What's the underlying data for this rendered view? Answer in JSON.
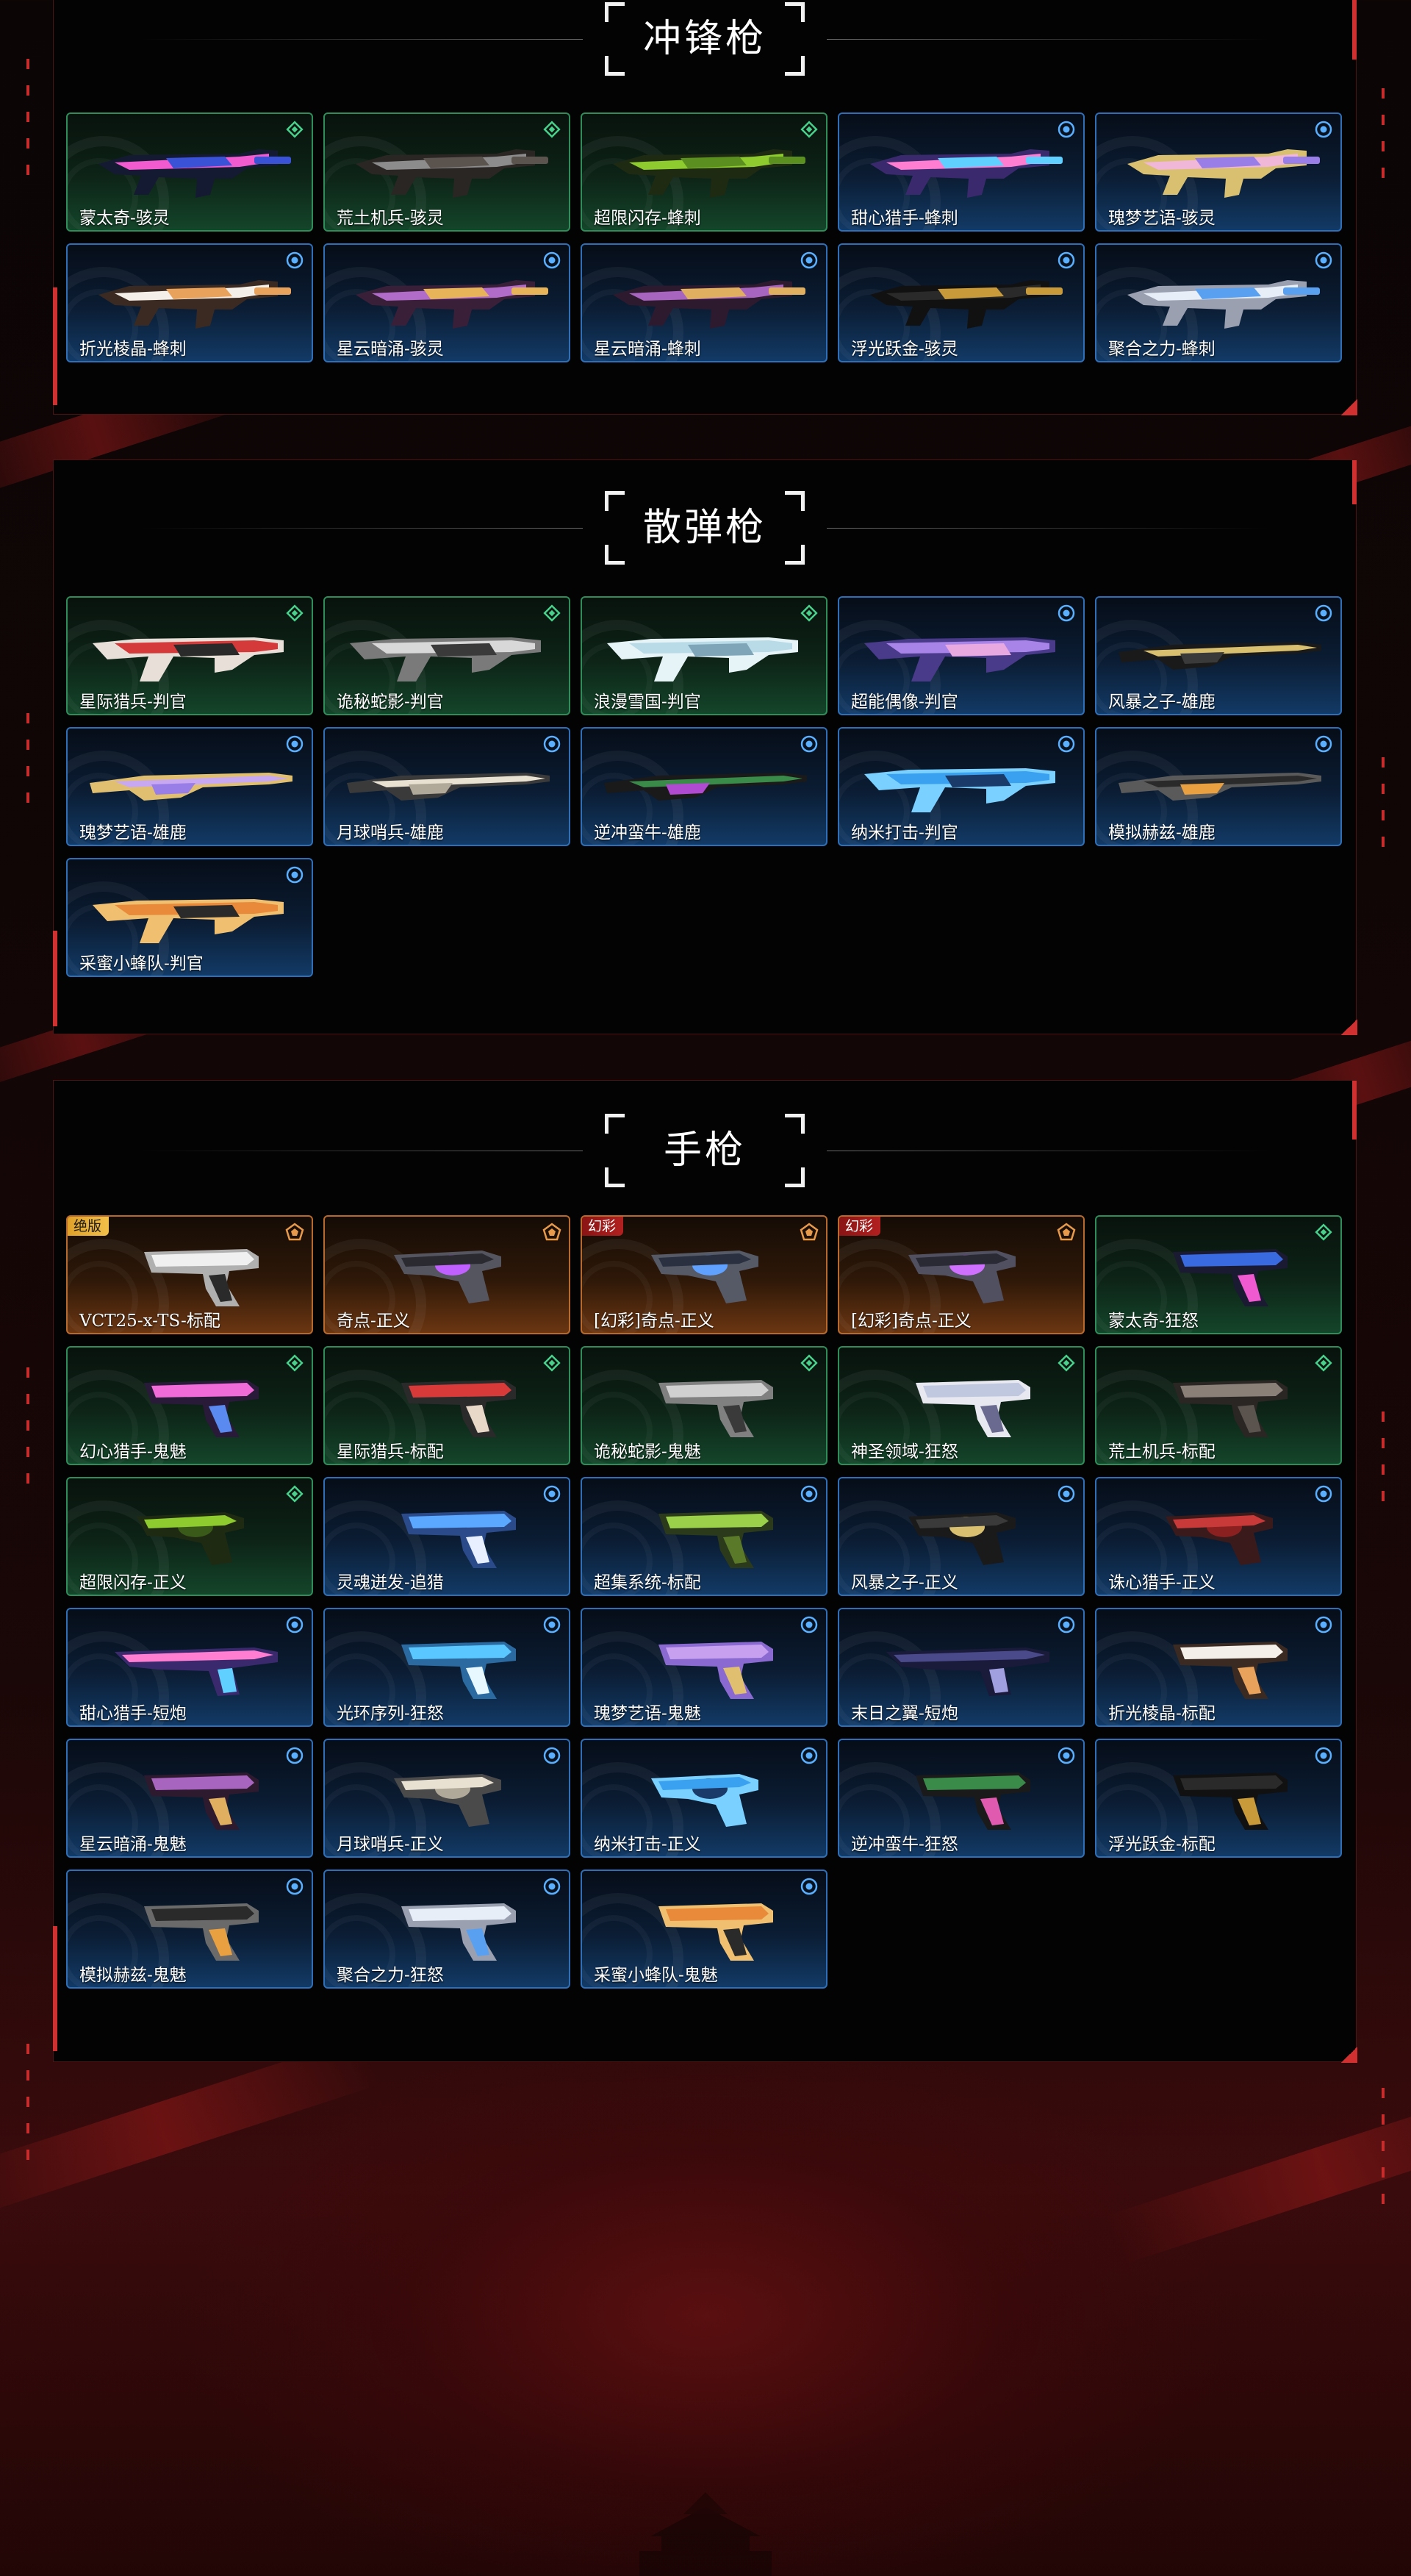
{
  "colors": {
    "accent_red": "#d0302f",
    "card_green": "#2f8d5a",
    "card_blue": "#2e6fb8",
    "card_orange": "#b86a2c",
    "gold_badge": "#e8b03a"
  },
  "sections": [
    {
      "title": "冲锋枪",
      "items": [
        {
          "name": "蒙太奇-骇灵",
          "tier": "green",
          "weapon": "smg",
          "hue": [
            "#f25bd0",
            "#3a53d6",
            "#151a33"
          ]
        },
        {
          "name": "荒土机兵-骇灵",
          "tier": "green",
          "weapon": "smg",
          "hue": [
            "#8c8c8c",
            "#5a534e",
            "#2a2624"
          ]
        },
        {
          "name": "超限闪存-蜂刺",
          "tier": "green",
          "weapon": "smg",
          "hue": [
            "#8ecb2e",
            "#5b8f1f",
            "#1f2a12"
          ]
        },
        {
          "name": "甜心猎手-蜂刺",
          "tier": "blue",
          "weapon": "smg",
          "hue": [
            "#ff7ed1",
            "#5fd0ff",
            "#3a2a6d"
          ]
        },
        {
          "name": "瑰梦艺语-骇灵",
          "tier": "blue",
          "weapon": "smg",
          "hue": [
            "#f0b7d9",
            "#9a7ee8",
            "#d9c070"
          ]
        },
        {
          "name": "折光棱晶-蜂刺",
          "tier": "blue",
          "weapon": "smg",
          "hue": [
            "#f4efe8",
            "#e8a25c",
            "#3a2a22"
          ]
        },
        {
          "name": "星云暗涌-骇灵",
          "tier": "blue",
          "weapon": "smg",
          "hue": [
            "#b06cc8",
            "#e8b45a",
            "#3a1f38"
          ]
        },
        {
          "name": "星云暗涌-蜂刺",
          "tier": "blue",
          "weapon": "smg",
          "hue": [
            "#a865c0",
            "#e0b060",
            "#2e1a2e"
          ]
        },
        {
          "name": "浮光跃金-骇灵",
          "tier": "blue",
          "weapon": "smg",
          "hue": [
            "#2a2a2a",
            "#c89a3a",
            "#111111"
          ]
        },
        {
          "name": "聚合之力-蜂刺",
          "tier": "blue",
          "weapon": "smg",
          "hue": [
            "#e8eef8",
            "#5aa0f0",
            "#9aa0b0"
          ]
        }
      ]
    },
    {
      "title": "散弹枪",
      "items": [
        {
          "name": "星际猎兵-判官",
          "tier": "green",
          "weapon": "shotgun",
          "hue": [
            "#d43a3a",
            "#2a2a2a",
            "#e8e0d8"
          ]
        },
        {
          "name": "诡秘蛇影-判官",
          "tier": "green",
          "weapon": "shotgun",
          "hue": [
            "#d8d8d8",
            "#3a3a3a",
            "#7a7a7a"
          ]
        },
        {
          "name": "浪漫雪国-判官",
          "tier": "green",
          "weapon": "shotgun",
          "hue": [
            "#b9dbe8",
            "#7fa6b8",
            "#e6f4f8"
          ]
        },
        {
          "name": "超能偶像-判官",
          "tier": "blue",
          "weapon": "shotgun",
          "hue": [
            "#a884e8",
            "#e8a8e0",
            "#4a3a8a"
          ]
        },
        {
          "name": "风暴之子-雄鹿",
          "tier": "blue",
          "weapon": "rifle",
          "hue": [
            "#d8c070",
            "#3a3a3a",
            "#1a1a1a"
          ]
        },
        {
          "name": "瑰梦艺语-雄鹿",
          "tier": "blue",
          "weapon": "rifle",
          "hue": [
            "#c8a8f0",
            "#9a7ee8",
            "#e0c070"
          ]
        },
        {
          "name": "月球哨兵-雄鹿",
          "tier": "blue",
          "weapon": "rifle",
          "hue": [
            "#e8e0d0",
            "#b0a898",
            "#3a3a3a"
          ]
        },
        {
          "name": "逆冲蛮牛-雄鹿",
          "tier": "blue",
          "weapon": "rifle",
          "hue": [
            "#3a8a4a",
            "#b04ad0",
            "#1a1a1a"
          ]
        },
        {
          "name": "纳米打击-判官",
          "tier": "blue",
          "weapon": "shotgun",
          "hue": [
            "#3aa0f0",
            "#1a3a6a",
            "#7ad0ff"
          ]
        },
        {
          "name": "模拟赫兹-雄鹿",
          "tier": "blue",
          "weapon": "rifle",
          "hue": [
            "#2a2a2a",
            "#e8a040",
            "#5a5a5a"
          ]
        },
        {
          "name": "采蜜小蜂队-判官",
          "tier": "blue",
          "weapon": "shotgun",
          "hue": [
            "#e88a3a",
            "#2a2a2a",
            "#f0c070"
          ]
        }
      ]
    },
    {
      "title": "手枪",
      "items": [
        {
          "name": "VCT25-x-TS-标配",
          "tier": "orange",
          "weapon": "pistol",
          "badge": "绝版",
          "badge_style": "gold",
          "hue": [
            "#f0f0f0",
            "#2a2a2a",
            "#b0b0b0"
          ]
        },
        {
          "name": "奇点-正义",
          "tier": "orange",
          "weapon": "revolver",
          "hue": [
            "#2a2a30",
            "#c060ff",
            "#555560"
          ]
        },
        {
          "name": "[幻彩]奇点-正义",
          "tier": "orange",
          "weapon": "revolver",
          "badge": "幻彩",
          "badge_style": "red",
          "hue": [
            "#2a3040",
            "#60a0ff",
            "#555a66"
          ]
        },
        {
          "name": "[幻彩]奇点-正义",
          "tier": "orange",
          "weapon": "revolver",
          "badge": "幻彩",
          "badge_style": "red",
          "hue": [
            "#2a2a35",
            "#d070ff",
            "#505060"
          ]
        },
        {
          "name": "蒙太奇-狂怒",
          "tier": "green",
          "weapon": "pistol",
          "hue": [
            "#3a6ae0",
            "#f05ad0",
            "#1a1a33"
          ]
        },
        {
          "name": "幻心猎手-鬼魅",
          "tier": "green",
          "weapon": "pistol",
          "hue": [
            "#f06ad8",
            "#5a8af0",
            "#2a1a3a"
          ]
        },
        {
          "name": "星际猎兵-标配",
          "tier": "green",
          "weapon": "pistol",
          "hue": [
            "#d83a3a",
            "#e8d8c8",
            "#2a2a2a"
          ]
        },
        {
          "name": "诡秘蛇影-鬼魅",
          "tier": "green",
          "weapon": "pistol",
          "hue": [
            "#d0d0d0",
            "#3a3a3a",
            "#808080"
          ]
        },
        {
          "name": "神圣领域-狂怒",
          "tier": "green",
          "weapon": "pistol",
          "hue": [
            "#c0c8e0",
            "#6a6a90",
            "#e8e8f0"
          ]
        },
        {
          "name": "荒土机兵-标配",
          "tier": "green",
          "weapon": "pistol",
          "hue": [
            "#8a8078",
            "#5a534e",
            "#2a2624"
          ]
        },
        {
          "name": "超限闪存-正义",
          "tier": "green",
          "weapon": "revolver",
          "hue": [
            "#8ecb2e",
            "#3a5a1a",
            "#1f2a12"
          ]
        },
        {
          "name": "灵魂迸发-追猎",
          "tier": "blue",
          "weapon": "pistol",
          "hue": [
            "#5aa8ff",
            "#e8f0ff",
            "#2a4a8a"
          ]
        },
        {
          "name": "超集系统-标配",
          "tier": "blue",
          "weapon": "pistol",
          "hue": [
            "#9ad04a",
            "#5a7a2a",
            "#2a3a1a"
          ]
        },
        {
          "name": "风暴之子-正义",
          "tier": "blue",
          "weapon": "revolver",
          "hue": [
            "#3a3a3a",
            "#d8c070",
            "#1a1a1a"
          ]
        },
        {
          "name": "诛心猎手-正义",
          "tier": "blue",
          "weapon": "revolver",
          "hue": [
            "#c83a3a",
            "#8a2020",
            "#3a1a1a"
          ]
        },
        {
          "name": "甜心猎手-短炮",
          "tier": "blue",
          "weapon": "shorty",
          "hue": [
            "#ff7ed1",
            "#5fd0ff",
            "#3a2a6d"
          ]
        },
        {
          "name": "光环序列-狂怒",
          "tier": "blue",
          "weapon": "pistol",
          "hue": [
            "#5ac8ff",
            "#e8f8ff",
            "#2a6aa0"
          ]
        },
        {
          "name": "瑰梦艺语-鬼魅",
          "tier": "blue",
          "weapon": "pistol",
          "hue": [
            "#c8a0f0",
            "#e0c070",
            "#8a6ad0"
          ]
        },
        {
          "name": "末日之翼-短炮",
          "tier": "blue",
          "weapon": "shorty",
          "hue": [
            "#4a4a8a",
            "#a0a0e0",
            "#1a1a3a"
          ]
        },
        {
          "name": "折光棱晶-标配",
          "tier": "blue",
          "weapon": "pistol",
          "hue": [
            "#f4efe8",
            "#e8a25c",
            "#3a2a22"
          ]
        },
        {
          "name": "星云暗涌-鬼魅",
          "tier": "blue",
          "weapon": "pistol",
          "hue": [
            "#a865c0",
            "#e0b060",
            "#2e1a2e"
          ]
        },
        {
          "name": "月球哨兵-正义",
          "tier": "blue",
          "weapon": "revolver",
          "hue": [
            "#e8e0d0",
            "#b0a898",
            "#4a4a4a"
          ]
        },
        {
          "name": "纳米打击-正义",
          "tier": "blue",
          "weapon": "revolver",
          "hue": [
            "#3aa0f0",
            "#1a3a6a",
            "#7ad0ff"
          ]
        },
        {
          "name": "逆冲蛮牛-狂怒",
          "tier": "blue",
          "weapon": "pistol",
          "hue": [
            "#3a8a4a",
            "#e05ab0",
            "#1a1a1a"
          ]
        },
        {
          "name": "浮光跃金-标配",
          "tier": "blue",
          "weapon": "pistol",
          "hue": [
            "#2a2a2a",
            "#c89a3a",
            "#111111"
          ]
        },
        {
          "name": "模拟赫兹-鬼魅",
          "tier": "blue",
          "weapon": "pistol",
          "hue": [
            "#2a2a2a",
            "#e8a040",
            "#6a6a6a"
          ]
        },
        {
          "name": "聚合之力-狂怒",
          "tier": "blue",
          "weapon": "pistol",
          "hue": [
            "#e8eef8",
            "#5aa0f0",
            "#9aa0b0"
          ]
        },
        {
          "name": "采蜜小蜂队-鬼魅",
          "tier": "blue",
          "weapon": "pistol",
          "hue": [
            "#e88a3a",
            "#2a2a2a",
            "#f0c070"
          ]
        }
      ]
    }
  ]
}
